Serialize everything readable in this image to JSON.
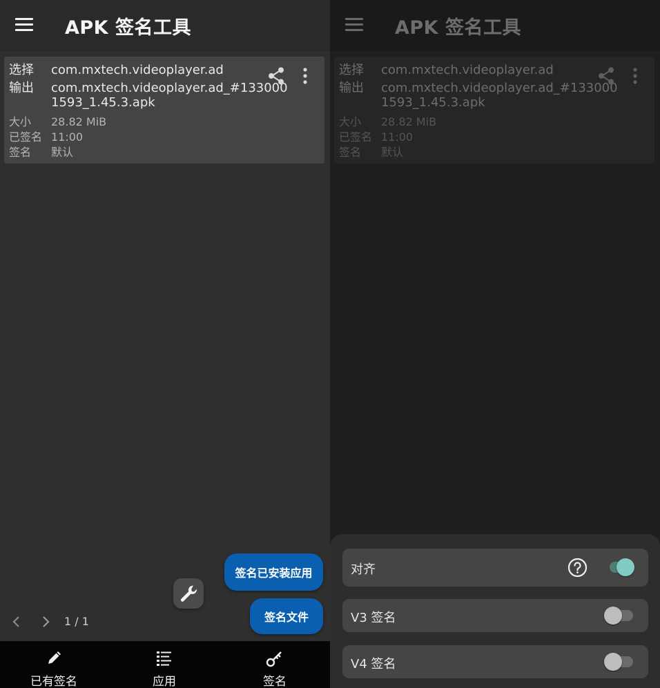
{
  "app": {
    "title": "APK 签名工具"
  },
  "file_card": {
    "select_label": "选择",
    "select_value": "com.mxtech.videoplayer.ad",
    "output_label": "输出",
    "output_value_line1": "com.mxtech.videoplayer.ad_#133000",
    "output_value_line2": "1593_1.45.3.apk",
    "size_label": "大小",
    "size_value": "28.82 MiB",
    "signed_label": "已签名",
    "signed_value": "11:00",
    "signature_label": "签名",
    "signature_value": "默认"
  },
  "fabs": {
    "sign_installed_label": "签名已安装应用",
    "sign_file_label": "签名文件"
  },
  "pager": {
    "text": "1 / 1"
  },
  "bottom_nav": {
    "items": [
      {
        "label": "已有签名",
        "icon": "pencil-icon"
      },
      {
        "label": "应用",
        "icon": "list-icon"
      },
      {
        "label": "签名",
        "icon": "key-icon"
      }
    ]
  },
  "sign_options": {
    "items": [
      {
        "label": "对齐",
        "enabled": true
      },
      {
        "label": "V3 签名",
        "enabled": false
      },
      {
        "label": "V4 签名",
        "enabled": false
      }
    ]
  },
  "colors": {
    "fab": "#0b5fb0",
    "switch_on": "#80cbc4",
    "switch_off": "#bdbdbd",
    "card": "#444444",
    "nav_background": "#050505"
  }
}
